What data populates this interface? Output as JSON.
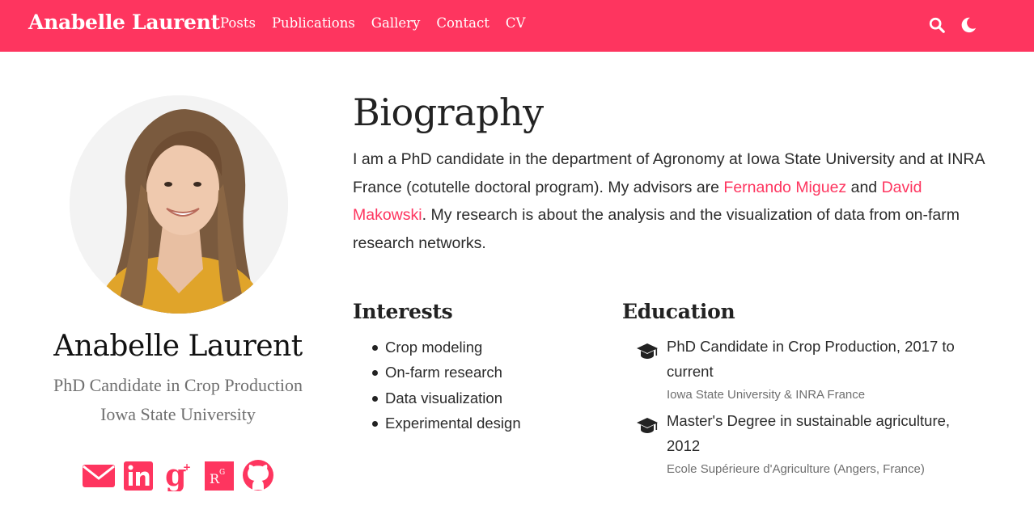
{
  "navbar": {
    "brand": "Anabelle Laurent",
    "links": [
      "Posts",
      "Publications",
      "Gallery",
      "Contact",
      "CV"
    ],
    "search_icon": "search-icon",
    "theme_icon": "moon-icon",
    "color": "#fe355f"
  },
  "profile": {
    "name": "Anabelle Laurent",
    "role": "PhD Candidate in Crop Production",
    "organization": "Iowa State University",
    "social_icons": [
      "envelope-icon",
      "linkedin-icon",
      "google-scholar-icon",
      "researchgate-icon",
      "github-icon"
    ]
  },
  "biography": {
    "title": "Biography",
    "text_before": "I am a PhD candidate in the department of Agronomy at Iowa State University and at INRA France (cotutelle doctoral program). My advisors are ",
    "advisor1": "Fernando Miguez",
    "text_and": " and ",
    "advisor2": "David Makowski",
    "text_after": ". My research is about the analysis and the visualization of data from on-farm research networks."
  },
  "interests": {
    "title": "Interests",
    "items": [
      "Crop modeling",
      "On-farm research",
      "Data visualization",
      "Experimental design"
    ]
  },
  "education": {
    "title": "Education",
    "items": [
      {
        "course": "PhD Candidate in Crop Production, 2017 to current",
        "institution": "Iowa State University & INRA France"
      },
      {
        "course": "Master's Degree in sustainable agriculture, 2012",
        "institution": "Ecole Supérieure d'Agriculture (Angers, France)"
      }
    ]
  },
  "accent_color": "#fe355f"
}
